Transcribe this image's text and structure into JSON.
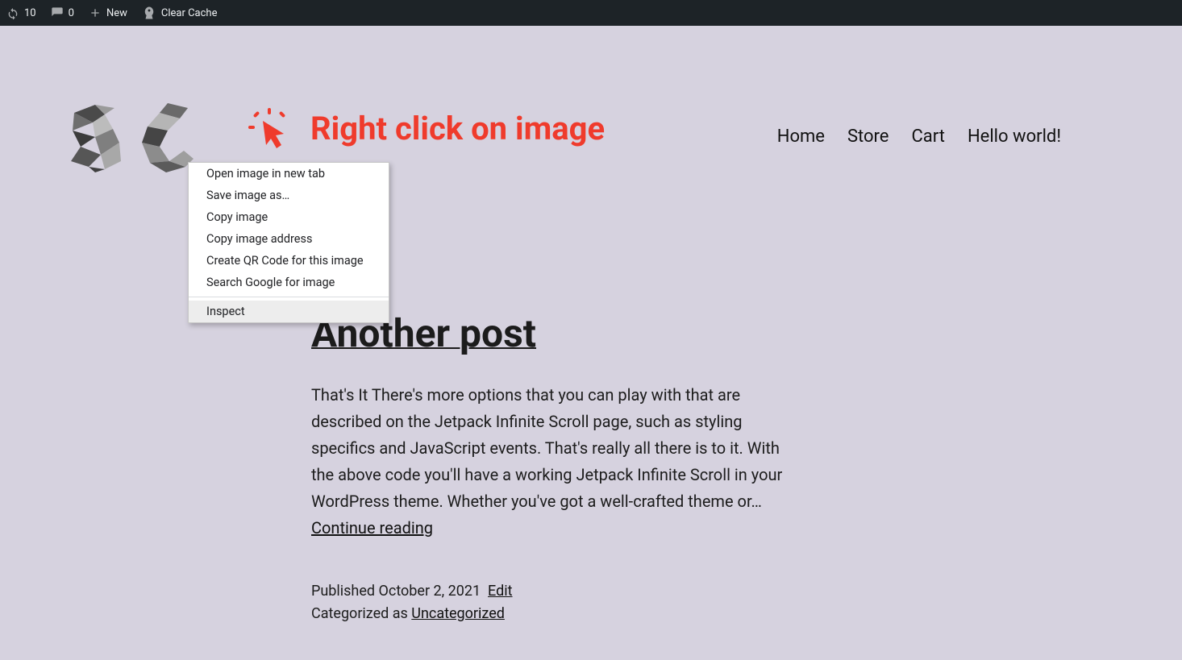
{
  "adminBar": {
    "refreshCount": "10",
    "commentsCount": "0",
    "newLabel": "New",
    "clearCache": "Clear Cache"
  },
  "annotation": {
    "text": "Right click on image"
  },
  "nav": {
    "items": [
      "Home",
      "Store",
      "Cart",
      "Hello world!"
    ]
  },
  "contextMenu": {
    "items": [
      "Open image in new tab",
      "Save image as…",
      "Copy image",
      "Copy image address",
      "Create QR Code for this image",
      "Search Google for image"
    ],
    "inspect": "Inspect"
  },
  "post": {
    "title": "Another post",
    "body": "That's It There's more options that you can play with that are described on the Jetpack Infinite Scroll page, such as styling specifics and JavaScript events. That's really all there is to it. With the above code you'll have a working Jetpack Infinite Scroll in your WordPress theme. Whether you've got a well-crafted theme or… ",
    "continue": "Continue reading",
    "publishedLabel": "Published ",
    "date": "October 2, 2021",
    "edit": "Edit",
    "categorizedLabel": "Categorized as ",
    "category": "Uncategorized"
  }
}
